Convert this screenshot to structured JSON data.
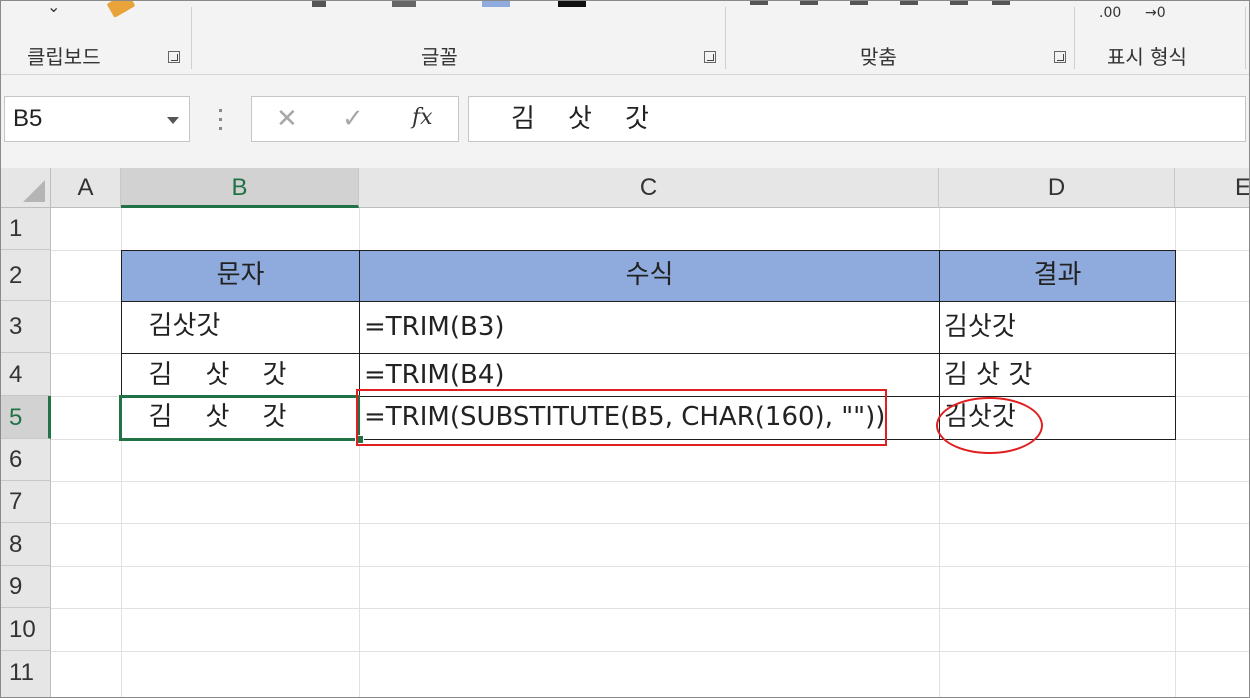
{
  "ribbon": {
    "groups": [
      {
        "label": "클립보드"
      },
      {
        "label": "글꼴"
      },
      {
        "label": "맞춤"
      },
      {
        "label": "표시 형식"
      }
    ],
    "number_format_icons": [
      ".00",
      "→0"
    ]
  },
  "formula_bar": {
    "name_box": "B5",
    "cancel_symbol": "✕",
    "enter_symbol": "✓",
    "fx_label": "fx",
    "formula_text": "김    삿    갓"
  },
  "grid": {
    "columns": [
      "A",
      "B",
      "C",
      "D",
      "E"
    ],
    "selected_column": "B",
    "rows": [
      "1",
      "2",
      "3",
      "4",
      "5",
      "6",
      "7",
      "8",
      "9",
      "10",
      "11"
    ],
    "selected_row": "5",
    "table": {
      "headers": [
        "문자",
        "수식",
        "결과"
      ],
      "rows": [
        {
          "text": "  김삿갓",
          "formula": "=TRIM(B3)",
          "result": "김삿갓"
        },
        {
          "text": "  김    삿    갓",
          "formula": "=TRIM(B4)",
          "result": "김 삿 갓"
        },
        {
          "text": "  김    삿    갓",
          "formula": "=TRIM(SUBSTITUTE(B5, CHAR(160), \"\"))",
          "result": "김삿갓"
        }
      ]
    },
    "active_cell": "B5",
    "highlight_color": "#e02020",
    "header_fill_color": "#8faadc",
    "selection_color": "#217346"
  }
}
